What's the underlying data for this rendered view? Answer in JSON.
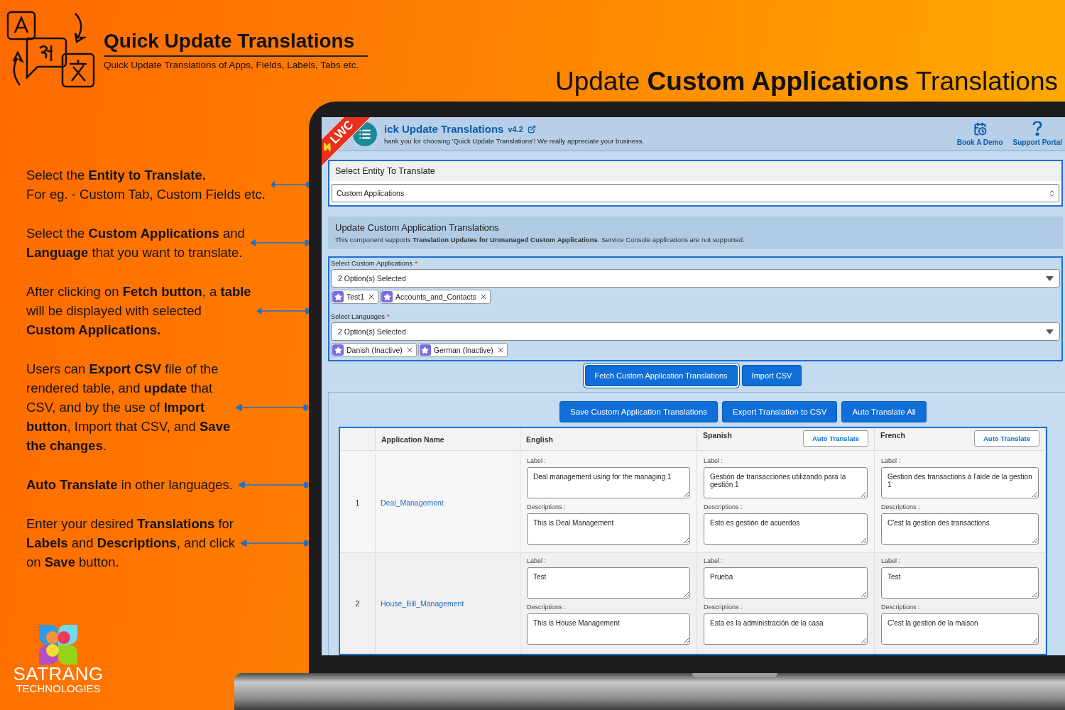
{
  "brand": {
    "title": "Quick Update Translations",
    "subtitle": "Quick Update Translations of Apps, Fields, Labels, Tabs etc."
  },
  "headline": "Update **Custom Applications** Translations",
  "callouts": [
    {
      "text": "Select the **Entity to Translate.**\nFor eg. - Custom Tab, Custom Fields etc."
    },
    {
      "text": "Select the **Custom Applications** and\n**Language** that you want to translate."
    },
    {
      "text": "After clicking on **Fetch button**, a **table**\nwill be displayed with selected\n**Custom Applications.**"
    },
    {
      "text": "Users can **Export CSV** file of the\nrendered table, and **update** that\nCSV, and by the use of **Import**\n**button**, Import that CSV, and **Save**\n**the changes**."
    },
    {
      "text": "**Auto Translate** in other languages."
    },
    {
      "text": "Enter your desired **Translations** for\n**Labels** and **Descriptions**, and click\non **Save** button."
    }
  ],
  "company": {
    "name": "SATRANG",
    "tagline": "TECHNOLOGIES"
  },
  "app": {
    "ribbon": "LWC",
    "title": "ick Update Translations",
    "version": "v4.2",
    "subtitle": "hank you for choosing 'Quick Update Translations'! We really appreciate your business.",
    "actions": [
      {
        "label": "Book A Demo",
        "kind": "calendar"
      },
      {
        "label": "Support Portal",
        "kind": "help"
      }
    ]
  },
  "entity": {
    "heading": "Select Entity To Translate",
    "value": "Custom Applications"
  },
  "info": {
    "title": "Update Custom Application Translations",
    "text": "This component supports **Translation Updates for Unmanaged Custom Applications**. Service Console applications are not supported."
  },
  "pickers": [
    {
      "label": "Select Custom Applications",
      "required_mark": "*",
      "value": "2 Option(s) Selected",
      "pills": [
        "Test1",
        "Accounts_and_Contacts"
      ]
    },
    {
      "label": "Select Languages",
      "required_mark": "*",
      "value": "2 Option(s) Selected",
      "pills": [
        "Danish (Inactive)",
        "German (Inactive)"
      ]
    }
  ],
  "actions": [
    {
      "label": "Fetch Custom Application Translations",
      "focused": true
    },
    {
      "label": "Import CSV",
      "focused": false
    }
  ],
  "table_actions": [
    "Save Custom Application Translations",
    "Export Translation to CSV",
    "Auto Translate All"
  ],
  "table": {
    "columns": [
      {},
      {
        "label": "Application Name"
      },
      {
        "label": "English"
      },
      {
        "label": "Spanish",
        "button": "Auto Translate"
      },
      {
        "label": "French",
        "button": "Auto Translate"
      }
    ],
    "rows": [
      {
        "cells": [
          {
            "kind": "number",
            "text": "1"
          },
          {
            "kind": "link",
            "text": "Deal_Management"
          },
          {
            "kind": "translation",
            "label_caption": "Label :",
            "label": "Deal management using for the managing 1",
            "description_caption": "Descriptions :",
            "description": "This is Deal Management"
          },
          {
            "kind": "translation",
            "label_caption": "Label :",
            "label": "Gestión de transacciones utilizando para la gestión 1",
            "description_caption": "Descriptions :",
            "description": "Esto es gestión de acuerdos"
          },
          {
            "kind": "translation",
            "label_caption": "Label :",
            "label": "Gestion des transactions à l'aide de la gestion 1",
            "description_caption": "Descriptions :",
            "description": "C'est la gestion des transactions"
          }
        ]
      },
      {
        "cells": [
          {
            "kind": "number",
            "text": "2"
          },
          {
            "kind": "link",
            "text": "House_Bill_Management"
          },
          {
            "kind": "translation",
            "label_caption": "Label :",
            "label": "Test",
            "description_caption": "Descriptions :",
            "description": "This is House Management"
          },
          {
            "kind": "translation",
            "label_caption": "Label :",
            "label": "Prueba",
            "description_caption": "Descriptions :",
            "description": "Esta es la administración de la casa"
          },
          {
            "kind": "translation",
            "label_caption": "Label :",
            "label": "Test",
            "description_caption": "Descriptions :",
            "description": "C'est la gestion de la maison"
          }
        ]
      }
    ]
  }
}
